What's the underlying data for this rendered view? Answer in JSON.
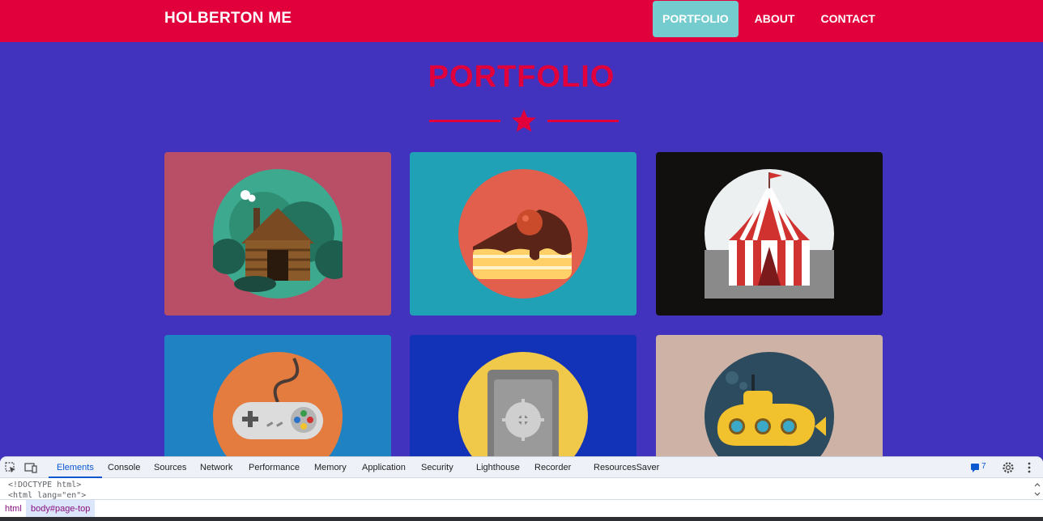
{
  "navbar": {
    "brand": "HOLBERTON ME",
    "links": [
      {
        "label": "PORTFOLIO",
        "active": true
      },
      {
        "label": "ABOUT",
        "active": false
      },
      {
        "label": "CONTACT",
        "active": false
      }
    ]
  },
  "masthead": {
    "title": "PORTFOLIO",
    "divider_icon": "star-icon"
  },
  "portfolio": {
    "items": [
      {
        "icon": "cabin-icon",
        "color": "#b94f66"
      },
      {
        "icon": "cake-icon",
        "color": "#21a1b6"
      },
      {
        "icon": "circus-tent-icon",
        "color": "#120f0f"
      },
      {
        "icon": "game-controller-icon",
        "color": "#1f82c3"
      },
      {
        "icon": "safe-icon",
        "color": "#1232b7"
      },
      {
        "icon": "submarine-icon",
        "color": "#cdb2a5"
      }
    ]
  },
  "colors": {
    "accent": "#e2003c",
    "background": "#4133bd",
    "active_nav": "#74cccf"
  },
  "devtools": {
    "tabs": [
      "Elements",
      "Console",
      "Sources",
      "Network",
      "Performance",
      "Memory",
      "Application",
      "Security",
      "Lighthouse",
      "Recorder",
      "ResourcesSaver"
    ],
    "active_tab": "Elements",
    "issues_count": "7",
    "code_lines": [
      "<!DOCTYPE html>",
      "<html lang=\"en\">"
    ],
    "breadcrumb": [
      "html",
      "body#page-top"
    ]
  }
}
